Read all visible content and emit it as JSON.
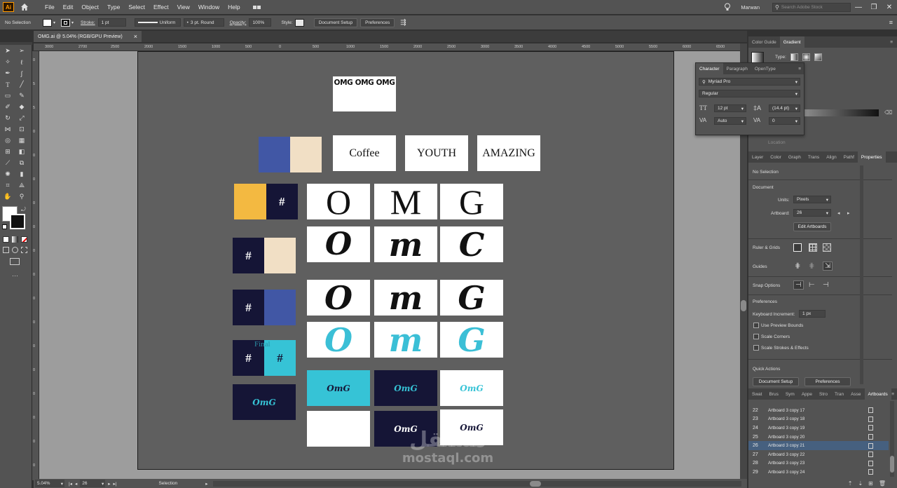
{
  "app": {
    "logo": "Ai",
    "user": "Marwan",
    "search_placeholder": "Search Adobe Stock"
  },
  "menu": [
    "File",
    "Edit",
    "Object",
    "Type",
    "Select",
    "Effect",
    "View",
    "Window",
    "Help"
  ],
  "control": {
    "selection": "No Selection",
    "stroke_label": "Stroke:",
    "stroke_weight": "1 pt",
    "stroke_profile": "Uniform",
    "brush": "3 pt. Round",
    "opacity_label": "Opacity:",
    "opacity": "100%",
    "style_label": "Style:",
    "doc_setup": "Document Setup",
    "preferences": "Preferences"
  },
  "doc_tab": {
    "title": "OMG.ai @ 5.04% (RGB/GPU Preview)",
    "close": "×"
  },
  "ruler_h": [
    "3000",
    "2700",
    "2500",
    "2000",
    "1500",
    "1000",
    "500",
    "0",
    "500",
    "1000",
    "1500",
    "2000",
    "2500",
    "3000",
    "3500",
    "4000",
    "4500",
    "5000",
    "5500",
    "6000",
    "6500",
    "7000",
    "7500"
  ],
  "ruler_v": [
    "0",
    "5",
    "5",
    "0",
    "0",
    "0",
    "0",
    "0",
    "0",
    "0",
    "0",
    "0",
    "0",
    "0",
    "0",
    "0",
    "0",
    "0"
  ],
  "artwork": {
    "omg_headline": "OMG OMG OMG",
    "words": [
      "Coffee",
      "YOUTH",
      "AMAZING"
    ],
    "hash": "#",
    "final": "Final",
    "row_serif": [
      "O",
      "M",
      "G"
    ],
    "row_brush1": [
      "O",
      "m",
      "C"
    ],
    "row_brush2": [
      "O",
      "m",
      "G"
    ],
    "row_brush3": [
      "O",
      "m",
      "G"
    ],
    "logo": "OmG",
    "colors": {
      "blue": "#4157a5",
      "cream": "#f1dfc5",
      "yellow": "#f3b941",
      "navy": "#151536",
      "cyan": "#36c3d6"
    }
  },
  "status": {
    "zoom": "5.04%",
    "artboard": "26",
    "tool": "Selection"
  },
  "right_top_tabs": [
    "Color Guide",
    "Gradient"
  ],
  "gradient": {
    "type_label": "Type:",
    "location_label": "Location"
  },
  "character": {
    "tabs": [
      "Character",
      "Paragraph",
      "OpenType"
    ],
    "font": "Myriad Pro",
    "style": "Regular",
    "size": "12 pt",
    "leading": "(14.4 pt)",
    "kerning": "Auto",
    "tracking": "0"
  },
  "props_tabs": [
    "Layer",
    "Color",
    "Graph",
    "Trans",
    "Align",
    "Pathf",
    "Properties"
  ],
  "properties": {
    "no_selection": "No Selection",
    "document": "Document",
    "units_label": "Units:",
    "units": "Pixels",
    "artboard_label": "Artboard:",
    "artboard": "26",
    "edit_artboards": "Edit Artboards",
    "rulers": "Ruler & Grids",
    "guides": "Guides",
    "snap": "Snap Options",
    "preferences": "Preferences",
    "keyboard_inc_label": "Keyboard Increment:",
    "keyboard_inc": "1 px",
    "preview_bounds": "Use Preview Bounds",
    "scale_corners": "Scale Corners",
    "scale_strokes": "Scale Strokes & Effects",
    "quick_actions": "Quick Actions",
    "doc_setup": "Document Setup",
    "prefs_btn": "Preferences"
  },
  "bottom_tabs": [
    "Swat",
    "Brus",
    "Sym",
    "Appe",
    "Stro",
    "Tran",
    "Asse",
    "Artboards"
  ],
  "artboards": [
    {
      "n": "22",
      "name": "Artboard 3 copy 17"
    },
    {
      "n": "23",
      "name": "Artboard 3 copy 18"
    },
    {
      "n": "24",
      "name": "Artboard 3 copy 19"
    },
    {
      "n": "25",
      "name": "Artboard 3 copy 20"
    },
    {
      "n": "26",
      "name": "Artboard 3 copy 21"
    },
    {
      "n": "27",
      "name": "Artboard 3 copy 22"
    },
    {
      "n": "28",
      "name": "Artboard 3 copy 23"
    },
    {
      "n": "29",
      "name": "Artboard 3 copy 24"
    }
  ],
  "watermark": {
    "arabic": "مستقل",
    "latin": "mostaql.com"
  }
}
